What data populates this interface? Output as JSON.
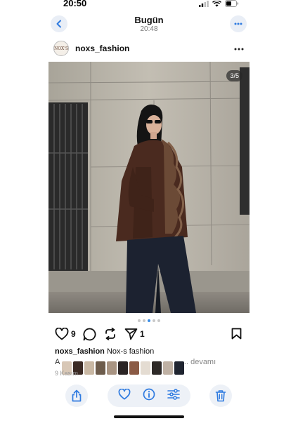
{
  "status_bar": {
    "time": "20:50"
  },
  "header": {
    "title": "Bugün",
    "subtitle": "20:48"
  },
  "post": {
    "username": "noxs_fashion",
    "avatar_text": "NOX'S",
    "page_counter": "3/5",
    "dots": {
      "total": 5,
      "active": 2
    },
    "likes": "9",
    "shares": "1",
    "caption_user": "noxs_fashion",
    "caption_text": "Nox-s fashion",
    "caption_line2": "A",
    "caption_more": "... devamı",
    "date": "9 Kasım"
  },
  "colors": {
    "accent": "#3a8ee6",
    "coat": "#4a2a1f",
    "pants": "#1c2230",
    "wall": "#b7b3aa"
  },
  "icons": {
    "back": "chevron-left-icon",
    "more": "ellipsis-icon",
    "like": "heart-icon",
    "comment": "comment-icon",
    "repost": "repost-icon",
    "share": "send-icon",
    "save": "bookmark-icon",
    "share_sheet": "share-icon",
    "info": "info-icon",
    "adjust": "sliders-icon",
    "delete": "trash-icon"
  }
}
